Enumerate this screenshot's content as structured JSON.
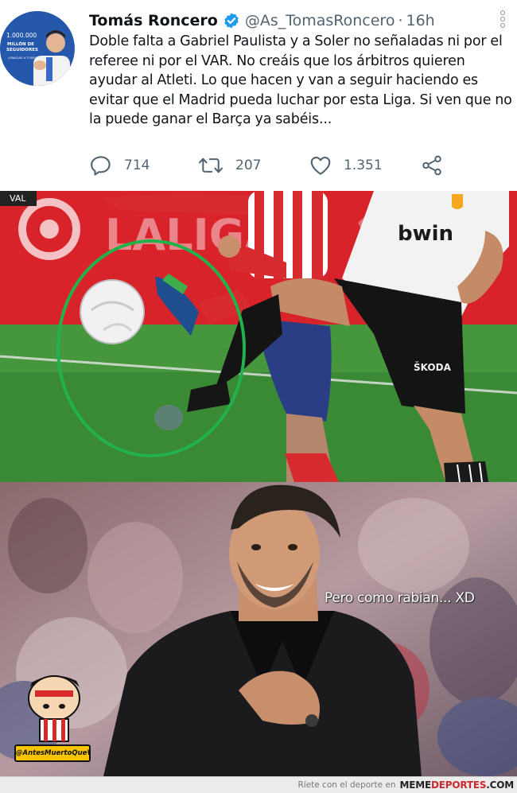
{
  "tweet": {
    "author_name": "Tomás Roncero",
    "author_handle": "@As_TomasRoncero",
    "separator": "·",
    "time": "16h",
    "verified": true,
    "text": "Doble falta a Gabriel Paulista y a Soler no señaladas ni por el referee ni por el VAR. No creáis que los árbitros quieren ayudar al Atleti. Lo que hacen  y van a seguir haciendo es evitar que el Madrid pueda luchar por esta Liga. Si ven que no la puede ganar el Barça ya sabéis...",
    "avatar_banner_line1": "1.000.000",
    "avatar_banner_line2": "MILLÓN DE",
    "avatar_banner_line3": "SEGUIDORES",
    "avatar_banner_line4": "¡GRACIAS A TODOS!",
    "actions": {
      "replies": "714",
      "retweets": "207",
      "likes": "1.351"
    },
    "icons": {
      "reply": "reply-icon",
      "retweet": "retweet-icon",
      "like": "heart-icon",
      "share": "share-icon",
      "more": "more-vertical-icon",
      "verified": "verified-badge-icon"
    },
    "colors": {
      "verified": "#1d9bf0",
      "icon_gray": "#536471"
    }
  },
  "photo1": {
    "tag": "VAL",
    "board_text": "LALIGA",
    "shirt_sponsor": "bwin",
    "shorts_brand": "ŠKODA",
    "circle_color": "#22b24c"
  },
  "photo2": {
    "caption": "Pero como rabian... XD",
    "sticker_label": "@AntesMuertoQueVikingo"
  },
  "footer": {
    "tagline": "Ríete con el deporte en",
    "brand_part1": "MEME",
    "brand_part2": "DEPORTES",
    "brand_part3": ".COM"
  }
}
